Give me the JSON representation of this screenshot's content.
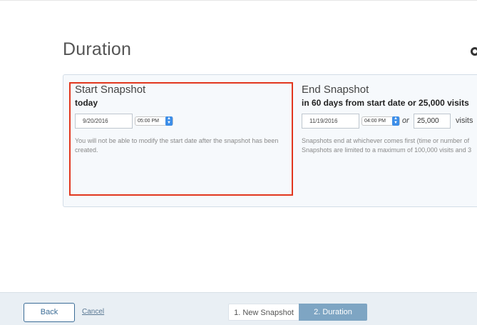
{
  "page": {
    "title": "Duration"
  },
  "start": {
    "title": "Start Snapshot",
    "subtitle": "today",
    "date": "9/20/2016",
    "time": "05:00 PM",
    "note_line1": "You will not be able to modify the start date after the snapshot has been",
    "note_line2": "created."
  },
  "end": {
    "title": "End Snapshot",
    "subtitle": "in 60 days from start date or 25,000 visits",
    "date": "11/19/2016",
    "time": "04:00 PM",
    "or_label": "or",
    "visits_value": "25,000",
    "visits_label": "visits",
    "note_line1": "Snapshots end at whichever comes first (time or number of",
    "note_line2": "Snapshots are limited to a maximum of 100,000 visits and 3"
  },
  "footer": {
    "back_label": "Back",
    "cancel_label": "Cancel",
    "steps": [
      {
        "label": "1. New Snapshot",
        "active": false
      },
      {
        "label": "2. Duration",
        "active": true
      }
    ]
  },
  "colors": {
    "highlight_border": "#e2371f",
    "active_step": "#7ea5c3",
    "primary": "#3c6d97",
    "spinner": "#3d8ee8"
  },
  "icons": {
    "time_spinner": "up-down-stepper-icon"
  }
}
